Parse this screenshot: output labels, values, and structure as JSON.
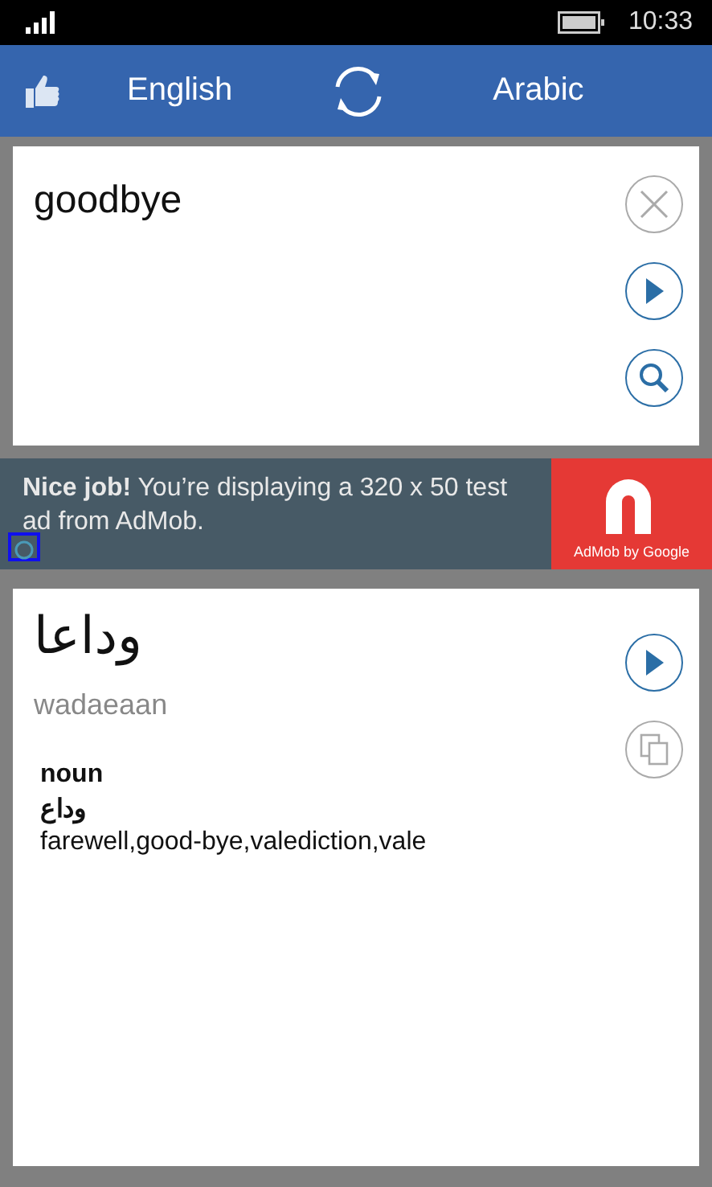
{
  "status_bar": {
    "time": "10:33"
  },
  "header": {
    "source_language": "English",
    "target_language": "Arabic"
  },
  "input": {
    "value": "goodbye"
  },
  "ad": {
    "text": "**Nice job!** You’re displaying a 320 x 50 test ad from AdMob.",
    "brand": "AdMob by Google"
  },
  "result": {
    "translation": "وداعا",
    "transliteration": "wadaeaan",
    "entries": [
      {
        "part_of_speech": "noun",
        "word": "وداع",
        "synonyms": "farewell,good-bye,valediction,vale"
      }
    ]
  }
}
